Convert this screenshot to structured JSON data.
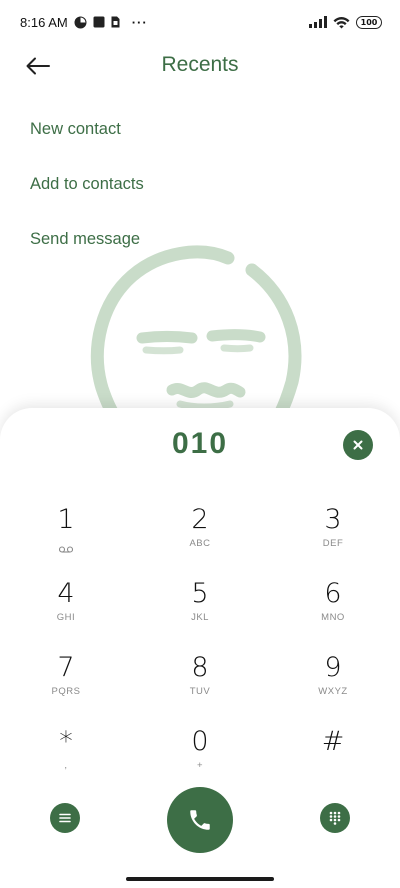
{
  "status_bar": {
    "time": "8:16 AM",
    "more": "···",
    "battery": "100",
    "icons": [
      "app-notification-icon",
      "square-notification-icon",
      "sim-card-icon",
      "signal-icon",
      "wifi-icon",
      "battery-icon"
    ]
  },
  "header": {
    "title": "Recents",
    "back_icon": "arrow-left-icon"
  },
  "menu": [
    {
      "label": "New contact"
    },
    {
      "label": "Add to contacts"
    },
    {
      "label": "Send message"
    }
  ],
  "dialer": {
    "number": "010",
    "clear_icon": "close-icon",
    "keys": [
      {
        "digit": "1",
        "letters": ""
      },
      {
        "digit": "2",
        "letters": "ABC"
      },
      {
        "digit": "3",
        "letters": "DEF"
      },
      {
        "digit": "4",
        "letters": "GHI"
      },
      {
        "digit": "5",
        "letters": "JKL"
      },
      {
        "digit": "6",
        "letters": "MNO"
      },
      {
        "digit": "7",
        "letters": "PQRS"
      },
      {
        "digit": "8",
        "letters": "TUV"
      },
      {
        "digit": "9",
        "letters": "WXYZ"
      },
      {
        "digit": "*",
        "letters": ","
      },
      {
        "digit": "0",
        "letters": "+"
      },
      {
        "digit": "#",
        "letters": ""
      }
    ],
    "bottom_icons": [
      "menu-icon",
      "phone-icon",
      "keypad-icon"
    ]
  },
  "colors": {
    "accent": "#3d6e46",
    "watermark": "#c9dcc9",
    "text": "#111111",
    "subtext": "#8a8a8a"
  }
}
